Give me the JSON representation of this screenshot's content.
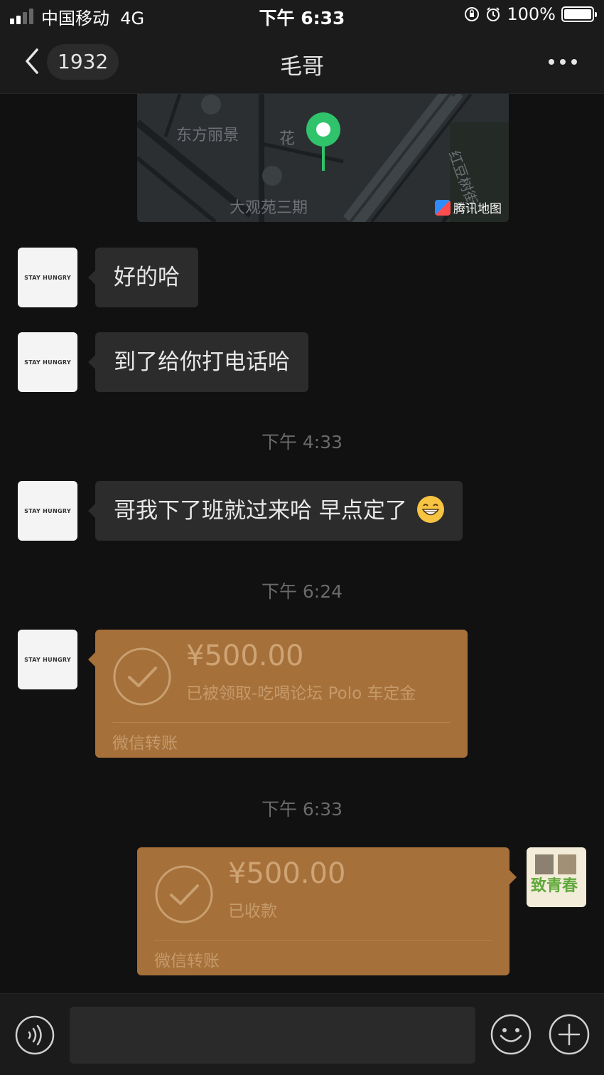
{
  "status_bar": {
    "carrier": "中国移动",
    "network": "4G",
    "time": "下午 6:33",
    "battery": "100%"
  },
  "nav": {
    "back_count": "1932",
    "title": "毛哥"
  },
  "map": {
    "labels": [
      "东方丽景",
      "花",
      "大观苑三期",
      "红豆树街"
    ],
    "brand": "腾讯地图"
  },
  "messages": {
    "msg1": "好的哈",
    "msg2": "到了给你打电话哈",
    "msg3": "哥我下了班就过来哈 早点定了",
    "avatar_text": "STAY HUNGRY"
  },
  "timestamps": {
    "t1": "下午 4:33",
    "t2": "下午 6:24",
    "t3": "下午 6:33"
  },
  "transfer_received": {
    "amount": "¥500.00",
    "description": "已被领取-吃喝论坛 Polo 车定金",
    "source": "微信转账"
  },
  "transfer_sent": {
    "amount": "¥500.00",
    "description": "已收款",
    "source": "微信转账"
  },
  "my_avatar_text": "致青春",
  "input": {
    "value": ""
  },
  "colors": {
    "background": "#111111",
    "bubble": "#2c2c2c",
    "transfer": "#a6703a",
    "map_pin": "#2fc36b"
  }
}
